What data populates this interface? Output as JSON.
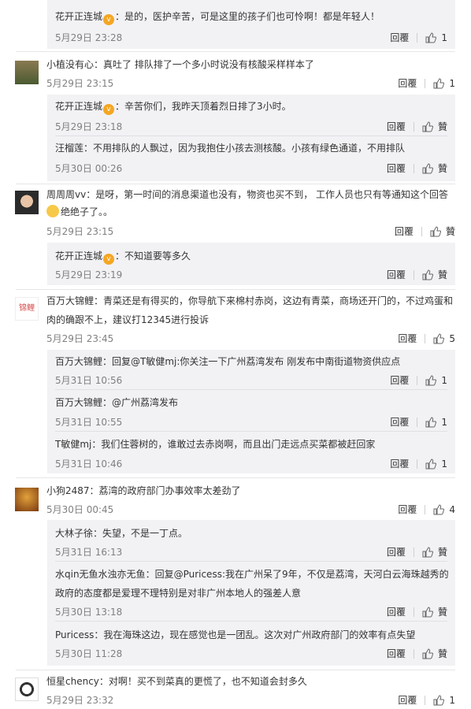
{
  "actions": {
    "reply_label": "回覆",
    "like_placeholder": "贊"
  },
  "c1": {
    "r1": {
      "name": "花开正连城",
      "text": "：是的，医护辛苦，可是这里的孩子们也可怜啊！都是年轻人！",
      "time": "5月29日 23:28",
      "likes": "1"
    }
  },
  "c2": {
    "name": "小植没有心",
    "text": "：真吐了 排队排了一个多小时说没有核酸采样样本了",
    "time": "5月29日 23:15",
    "likes": "1",
    "r1": {
      "name": "花开正连城",
      "text": "：辛苦你们，我昨天顶着烈日排了3小时。",
      "time": "5月29日 23:18"
    },
    "r2": {
      "name": "汪榴莲",
      "text": "：不用排队的人飘过，因为我抱住小孩去测核酸。小孩有绿色通道，不用排队",
      "time": "5月30日 00:26"
    }
  },
  "c3": {
    "name": "周周周vv",
    "text_line1": "：是呀，第一时间的消息渠道也没有，物资也买不到， 工作人员也只有等通知这个回答",
    "text_line2": "绝绝子了。。",
    "time": "5月29日 23:15",
    "r1": {
      "name": "花开正连城",
      "text": "：不知道要等多久",
      "time": "5月29日 23:19"
    }
  },
  "c4": {
    "name": "百万大锦鲤",
    "avatar_text": "锦鲤",
    "text_line1": "：青菜还是有得买的，你导航下来棉村赤岗，这边有青菜，商场还开门的，不过鸡蛋和",
    "text_line2": "肉的确跟不上，建议打12345进行投诉",
    "time": "5月29日 23:45",
    "likes": "5",
    "r1": {
      "name": "百万大锦鲤",
      "text": "：回复@T敏健mj:你关注一下广州荔湾发布  刚发布中南街道物资供应点",
      "time": "5月31日 10:56",
      "likes": "1"
    },
    "r2": {
      "name": "百万大锦鲤",
      "text": "：@广州荔湾发布",
      "time": "5月31日 10:55",
      "likes": "1"
    },
    "r3": {
      "name": "T敏健mj",
      "text": "：我们住蓉树的，谁敢过去赤岗啊，而且出门走远点买菜都被赶回家",
      "time": "5月31日 10:46",
      "likes": "1"
    }
  },
  "c5": {
    "name": "小狗2487",
    "text": "：荔湾的政府部门办事效率太差劲了",
    "time": "5月30日 00:45",
    "likes": "4",
    "r1": {
      "name": "大林子徐",
      "text": "：失望，不是一丁点。",
      "time": "5月31日 16:13"
    },
    "r2": {
      "name": "水qin无鱼水浊亦无鱼",
      "text_line1": "：回复@Puricess:我在广州呆了9年，不仅是荔湾，天河白云海珠越秀的",
      "text_line2": "政府的态度都是爱理不理特别是对非广州本地人的强差人意",
      "time": "5月30日 13:18"
    },
    "r3": {
      "name": "Puricess",
      "text": "：我在海珠这边，现在感觉也是一团乱。这次对广州政府部门的效率有点失望",
      "time": "5月30日 11:28"
    }
  },
  "c6": {
    "name": "恒星chency",
    "text": "：对啊！买不到菜真的更慌了，也不知道会封多久",
    "time": "5月29日 23:32",
    "likes": "1"
  }
}
